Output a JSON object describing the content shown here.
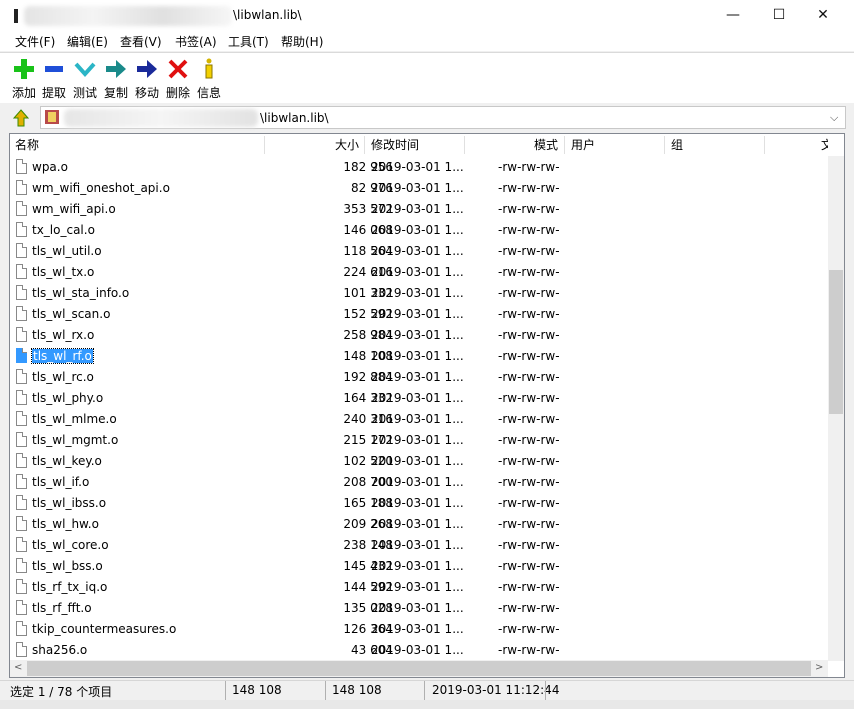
{
  "window": {
    "title_prefix": "[",
    "title": "\\libwlan.lib\\",
    "controls": {
      "minimize": "—",
      "maximize": "☐",
      "close": "✕"
    }
  },
  "menu": [
    "文件(F)",
    "编辑(E)",
    "查看(V)",
    "书签(A)",
    "工具(T)",
    "帮助(H)"
  ],
  "toolbar": [
    {
      "label": "添加",
      "icon": "add-icon",
      "color": "#19c219"
    },
    {
      "label": "提取",
      "icon": "extract-icon",
      "color": "#1f4fd8"
    },
    {
      "label": "测试",
      "icon": "test-icon",
      "color": "#2bb5c6"
    },
    {
      "label": "复制",
      "icon": "copy-icon",
      "color": "#1a8a8a"
    },
    {
      "label": "移动",
      "icon": "move-icon",
      "color": "#1a2a9a"
    },
    {
      "label": "删除",
      "icon": "delete-icon",
      "color": "#e01010"
    },
    {
      "label": "信息",
      "icon": "info-icon",
      "color": "#d4b400"
    }
  ],
  "address": {
    "path": "\\libwlan.lib\\"
  },
  "columns": [
    "名称",
    "大小",
    "修改时间",
    "模式",
    "用户",
    "组",
    "文"
  ],
  "files": [
    {
      "name": "wpa.o",
      "size": "182 956",
      "date": "2019-03-01 1...",
      "mode": "-rw-rw-rw-"
    },
    {
      "name": "wm_wifi_oneshot_api.o",
      "size": "82 976",
      "date": "2019-03-01 1...",
      "mode": "-rw-rw-rw-"
    },
    {
      "name": "wm_wifi_api.o",
      "size": "353 572",
      "date": "2019-03-01 1...",
      "mode": "-rw-rw-rw-"
    },
    {
      "name": "tx_lo_cal.o",
      "size": "146 068",
      "date": "2019-03-01 1...",
      "mode": "-rw-rw-rw-"
    },
    {
      "name": "tls_wl_util.o",
      "size": "118 564",
      "date": "2019-03-01 1...",
      "mode": "-rw-rw-rw-"
    },
    {
      "name": "tls_wl_tx.o",
      "size": "224 616",
      "date": "2019-03-01 1...",
      "mode": "-rw-rw-rw-"
    },
    {
      "name": "tls_wl_sta_info.o",
      "size": "101 332",
      "date": "2019-03-01 1...",
      "mode": "-rw-rw-rw-"
    },
    {
      "name": "tls_wl_scan.o",
      "size": "152 592",
      "date": "2019-03-01 1...",
      "mode": "-rw-rw-rw-"
    },
    {
      "name": "tls_wl_rx.o",
      "size": "258 984",
      "date": "2019-03-01 1...",
      "mode": "-rw-rw-rw-"
    },
    {
      "name": "tls_wl_rf.o",
      "size": "148 108",
      "date": "2019-03-01 1...",
      "mode": "-rw-rw-rw-",
      "selected": true
    },
    {
      "name": "tls_wl_rc.o",
      "size": "192 884",
      "date": "2019-03-01 1...",
      "mode": "-rw-rw-rw-"
    },
    {
      "name": "tls_wl_phy.o",
      "size": "164 332",
      "date": "2019-03-01 1...",
      "mode": "-rw-rw-rw-"
    },
    {
      "name": "tls_wl_mlme.o",
      "size": "240 316",
      "date": "2019-03-01 1...",
      "mode": "-rw-rw-rw-"
    },
    {
      "name": "tls_wl_mgmt.o",
      "size": "215 172",
      "date": "2019-03-01 1...",
      "mode": "-rw-rw-rw-"
    },
    {
      "name": "tls_wl_key.o",
      "size": "102 520",
      "date": "2019-03-01 1...",
      "mode": "-rw-rw-rw-"
    },
    {
      "name": "tls_wl_if.o",
      "size": "208 700",
      "date": "2019-03-01 1...",
      "mode": "-rw-rw-rw-"
    },
    {
      "name": "tls_wl_ibss.o",
      "size": "165 188",
      "date": "2019-03-01 1...",
      "mode": "-rw-rw-rw-"
    },
    {
      "name": "tls_wl_hw.o",
      "size": "209 268",
      "date": "2019-03-01 1...",
      "mode": "-rw-rw-rw-"
    },
    {
      "name": "tls_wl_core.o",
      "size": "238 148",
      "date": "2019-03-01 1...",
      "mode": "-rw-rw-rw-"
    },
    {
      "name": "tls_wl_bss.o",
      "size": "145 432",
      "date": "2019-03-01 1...",
      "mode": "-rw-rw-rw-"
    },
    {
      "name": "tls_rf_tx_iq.o",
      "size": "144 592",
      "date": "2019-03-01 1...",
      "mode": "-rw-rw-rw-"
    },
    {
      "name": "tls_rf_fft.o",
      "size": "135 028",
      "date": "2019-03-01 1...",
      "mode": "-rw-rw-rw-"
    },
    {
      "name": "tkip_countermeasures.o",
      "size": "126 364",
      "date": "2019-03-01 1...",
      "mode": "-rw-rw-rw-"
    },
    {
      "name": "sha256.o",
      "size": "43 604",
      "date": "2019-03-01 1...",
      "mode": "-rw-rw-rw-"
    }
  ],
  "status": {
    "selection": "选定 1 / 78 个项目",
    "size": "148 108",
    "packed": "148 108",
    "modified": "2019-03-01 11:12:44"
  }
}
